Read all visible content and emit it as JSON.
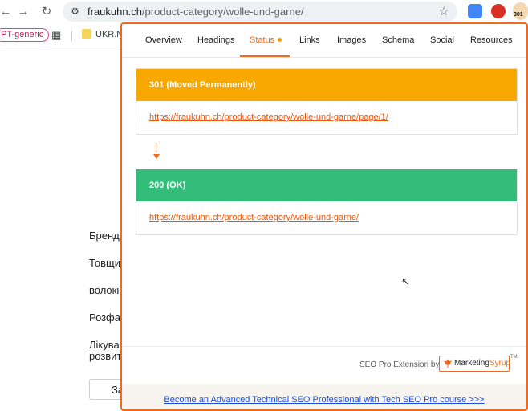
{
  "browser": {
    "url_host": "fraukuhn.ch",
    "url_path": "/product-category/wolle-und-garne/",
    "extension_badge": "301"
  },
  "bookmarks": {
    "pill_label": "PT-generic",
    "item_label": "UKR.NE"
  },
  "background_page": {
    "items": [
      "Бренд",
      "Товщи",
      "волокн",
      "Розфа",
      "Лікува",
      "розвит"
    ],
    "button_label": "За"
  },
  "popup": {
    "tabs": [
      {
        "label": "Overview"
      },
      {
        "label": "Headings"
      },
      {
        "label": "Status"
      },
      {
        "label": "Links"
      },
      {
        "label": "Images"
      },
      {
        "label": "Schema"
      },
      {
        "label": "Social"
      },
      {
        "label": "Resources"
      }
    ],
    "active_tab": "Status",
    "redirects": [
      {
        "status": "301 (Moved Permanently)",
        "url": "https://fraukuhn.ch/product-category/wolle-und-garne/page/1/",
        "color": "#f8a800"
      },
      {
        "status": "200 (OK)",
        "url": "https://fraukuhn.ch/product-category/wolle-und-garne/",
        "color": "#33bd7a"
      }
    ],
    "powered_by": "SEO Pro Extension by",
    "brand_part1": "Marketing",
    "brand_part2": "Syrup",
    "trademark": "TM",
    "promo_link": "Become an Advanced Technical SEO Professional with Tech SEO Pro course >>>"
  },
  "colors": {
    "accent": "#f06a1d",
    "status_redirect": "#f8a800",
    "status_ok": "#33bd7a",
    "link": "#e8590c"
  }
}
